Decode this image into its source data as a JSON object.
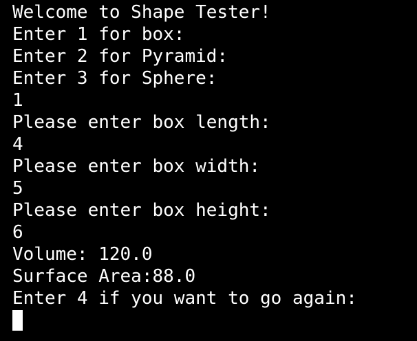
{
  "terminal": {
    "lines": [
      "Welcome to Shape Tester!",
      "Enter 1 for box:",
      "Enter 2 for Pyramid:",
      "Enter 3 for Sphere:",
      "1",
      "Please enter box length:",
      "4",
      "Please enter box width:",
      "5",
      "Please enter box height:",
      "6",
      "Volume: 120.0",
      "Surface Area:88.0",
      "Enter 4 if you want to go again:"
    ],
    "colors": {
      "background": "#000000",
      "text": "#ffffff",
      "cursor": "#ffffff"
    }
  }
}
